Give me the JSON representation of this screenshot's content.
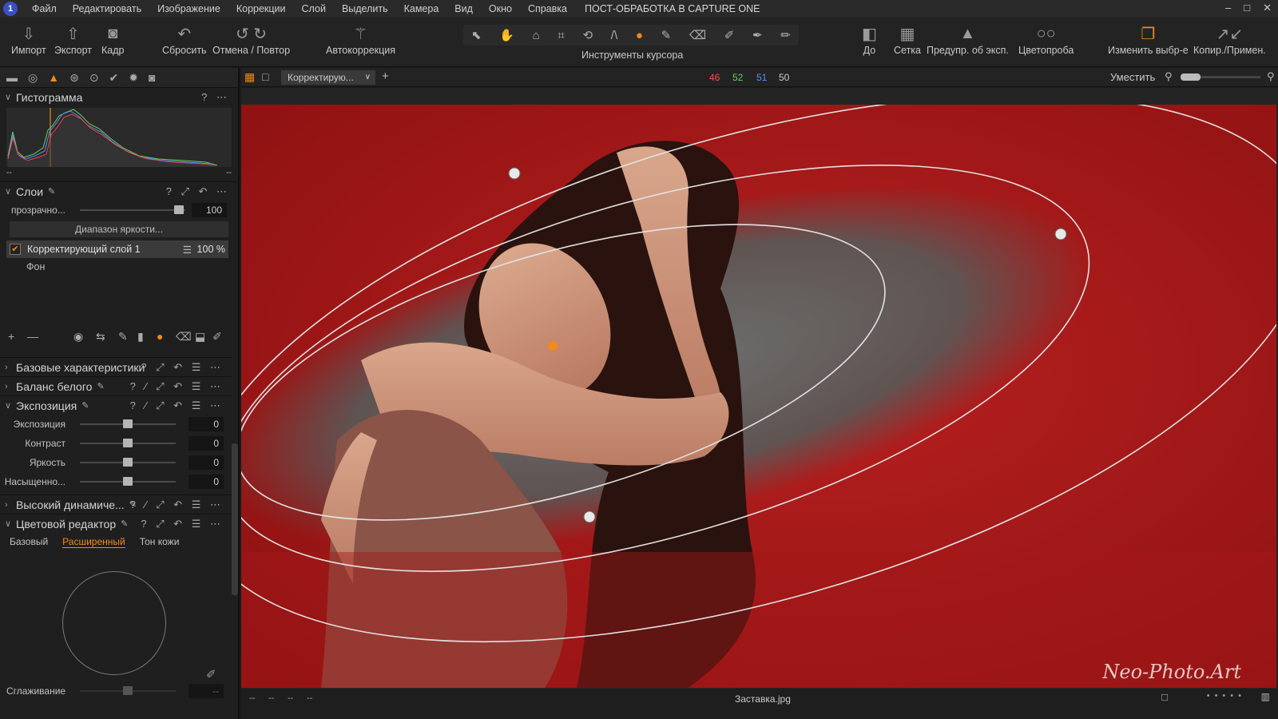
{
  "window": {
    "title": "ПОСТ-ОБРАБОТКА В CAPTURE ONE",
    "controls": [
      "–",
      "□",
      "✕"
    ]
  },
  "menu": [
    "Файл",
    "Редактировать",
    "Изображение",
    "Коррекции",
    "Слой",
    "Выделить",
    "Камера",
    "Вид",
    "Окно",
    "Справка"
  ],
  "toolbar": {
    "import": "Импорт",
    "export": "Экспорт",
    "frame": "Кадр",
    "reset": "Сбросить",
    "undo_redo": "Отмена / Повтор",
    "autocorrect": "Автокоррекция",
    "cursor_tools": "Инструменты курсора",
    "before": "До",
    "grid": "Сетка",
    "exposure_warning": "Предупр. об эксп.",
    "color_picker": "Цветопроба",
    "change_selection": "Изменить выбр-е",
    "copy_apply": "Копир./Примен."
  },
  "viewer_bar": {
    "layer_dropdown": "Корректирую...",
    "rgb": {
      "r": "46",
      "g": "52",
      "b": "51",
      "l": "50"
    },
    "fit": "Уместить",
    "zoom_fraction": 0.25
  },
  "histogram": {
    "title": "Гистограмма",
    "left_value": "--",
    "right_value": "--"
  },
  "layers": {
    "title": "Слои",
    "opacity_label": "прозрачно...",
    "opacity_value": "100",
    "opacity_fraction": 1.0,
    "luma_range_button": "Диапазон яркости...",
    "items": [
      {
        "name": "Корректирующий слой 1",
        "opacity": "100 %",
        "checked": true
      },
      {
        "name": "Фон"
      }
    ]
  },
  "sections": {
    "basic": "Базовые характеристики",
    "white_balance": "Баланс белого",
    "exposure": "Экспозиция",
    "hdr": "Высокий динамиче...",
    "color_editor": "Цветовой редактор"
  },
  "exposure_sliders": [
    {
      "label": "Экспозиция",
      "value": "0",
      "fraction": 0.5
    },
    {
      "label": "Контраст",
      "value": "0",
      "fraction": 0.5
    },
    {
      "label": "Яркость",
      "value": "0",
      "fraction": 0.5
    },
    {
      "label": "Насыщенно...",
      "value": "0",
      "fraction": 0.5
    }
  ],
  "color_editor": {
    "tabs": [
      "Базовый",
      "Расширенный",
      "Тон кожи"
    ],
    "active_tab": "Расширенный",
    "smoothing_label": "Сглаживание",
    "smoothing_value": "--"
  },
  "status": {
    "left": [
      "--",
      "--",
      "--",
      "--"
    ],
    "filename": "Заставка.jpg"
  },
  "watermark": "Neo-Photo.Art",
  "colors": {
    "accent": "#f08a1c",
    "red_channel": "#ff4b4b",
    "green_channel": "#5fd35f",
    "blue_channel": "#5a8cff"
  }
}
